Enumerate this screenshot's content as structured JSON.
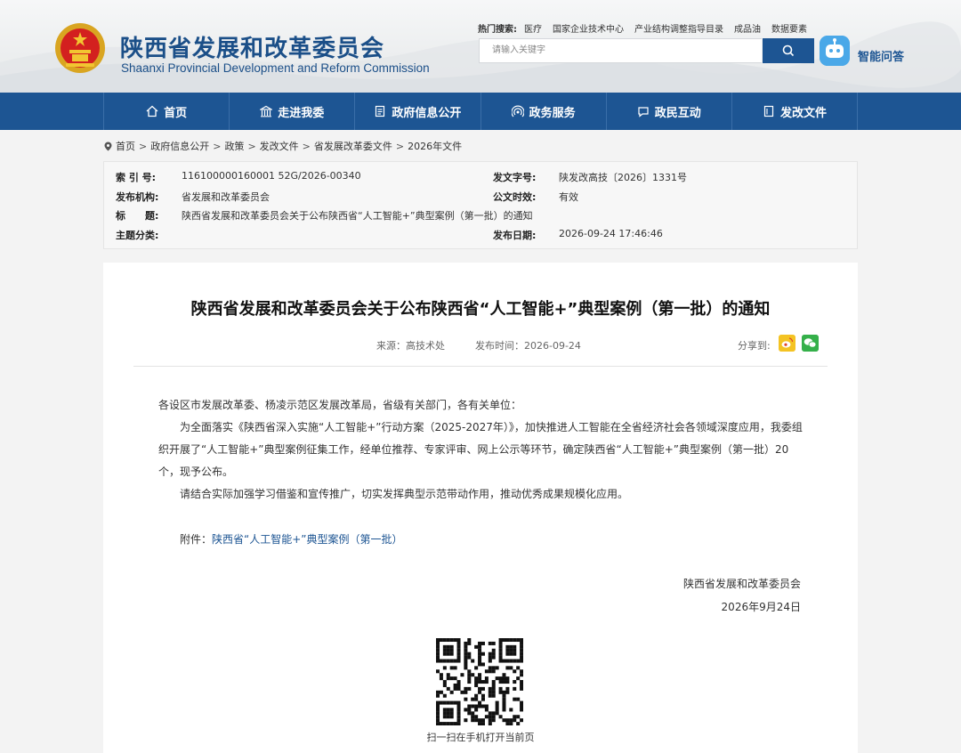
{
  "header": {
    "title": "陕西省发展和改革委员会",
    "subtitle": "Shaanxi Provincial Development and Reform Commission",
    "hot_search_label": "热门搜索:",
    "hot_search_items": [
      "医疗",
      "国家企业技术中心",
      "产业结构调整指导目录",
      "成品油",
      "数据要素"
    ],
    "search_placeholder": "请输入关键字",
    "ai_label": "智能问答"
  },
  "nav": {
    "items": [
      {
        "label": "首页",
        "icon": "home-icon"
      },
      {
        "label": "走进我委",
        "icon": "building-icon"
      },
      {
        "label": "政府信息公开",
        "icon": "document-icon"
      },
      {
        "label": "政务服务",
        "icon": "broadcast-icon"
      },
      {
        "label": "政民互动",
        "icon": "chat-icon"
      },
      {
        "label": "发改文件",
        "icon": "file-icon"
      }
    ]
  },
  "breadcrumb": [
    "首页",
    "政府信息公开",
    "政策",
    "发改文件",
    "省发展改革委文件",
    "2026年文件"
  ],
  "meta": {
    "index_label": "索 引 号:",
    "index_value": "116100000160001 52G/2026-00340",
    "doc_no_label": "发文字号:",
    "doc_no_value": "陕发改高技〔2026〕1331号",
    "org_label": "发布机构:",
    "org_value": "省发展和改革委员会",
    "status_label": "公文时效:",
    "status_value": "有效",
    "title_label": "标　　题:",
    "title_value": "陕西省发展和改革委员会关于公布陕西省“人工智能+”典型案例（第一批）的通知",
    "topic_label": "主题分类:",
    "topic_value": "",
    "date_label": "发布日期:",
    "date_value": "2026-09-24 17:46:46"
  },
  "article": {
    "title": "陕西省发展和改革委员会关于公布陕西省“人工智能+”典型案例（第一批）的通知",
    "source": "来源：高技术处",
    "publish_time": "发布时间：2026-09-24",
    "share_label": "分享到:",
    "salutation": "各设区市发展改革委、杨凌示范区发展改革局，省级有关部门，各有关单位：",
    "para1": "为全面落实《陕西省深入实施“人工智能+”行动方案（2025-2027年）》，加快推进人工智能在全省经济社会各领域深度应用，我委组织开展了“人工智能+”典型案例征集工作，经单位推荐、专家评审、网上公示等环节，确定陕西省“人工智能+”典型案例（第一批）20个，现予公布。",
    "para2": "请结合实际加强学习借鉴和宣传推广，切实发挥典型示范带动作用，推动优秀成果规模化应用。",
    "attach_label": "附件：",
    "attach_link": "陕西省“人工智能+”典型案例（第一批）",
    "signer": "陕西省发展和改革委员会",
    "sign_date": "2026年9月24日",
    "qr_caption": "扫一扫在手机打开当前页"
  },
  "colors": {
    "primary": "#1d5593",
    "title_blue": "#1b4f88",
    "weibo": "#f4c323",
    "wechat": "#35b04a"
  }
}
